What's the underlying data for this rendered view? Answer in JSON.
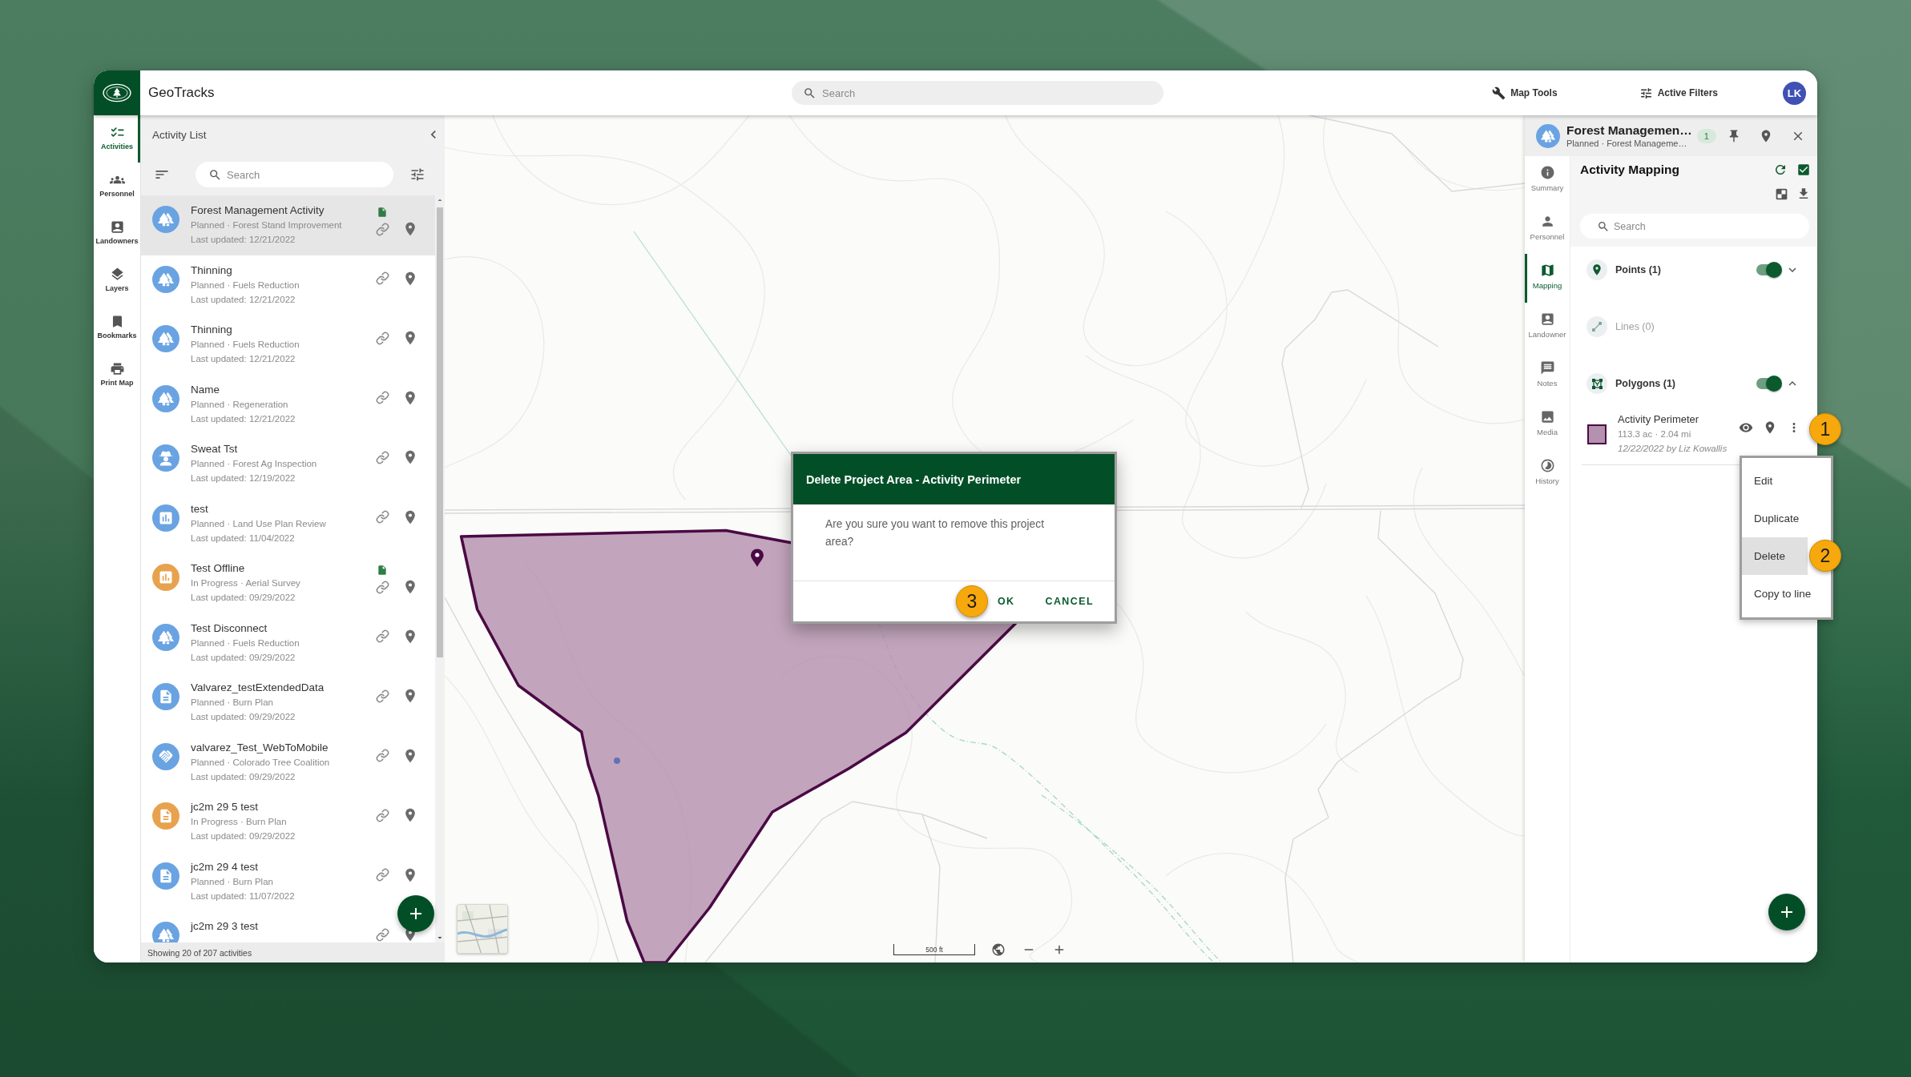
{
  "top_bar": {
    "app_name": "GeoTracks",
    "search": {
      "placeholder": "Search"
    },
    "tools": [
      "Map Tools",
      "Active Filters"
    ],
    "user_initials": "LK"
  },
  "nav": [
    {
      "label": "Activities",
      "selected": true
    },
    {
      "label": "Personnel",
      "selected": false
    },
    {
      "label": "Landowners",
      "selected": false
    },
    {
      "label": "Layers",
      "selected": false
    },
    {
      "label": "Bookmarks",
      "selected": false
    },
    {
      "label": "Print Map",
      "selected": false
    }
  ],
  "activity_list": {
    "title": "Activity List",
    "search": {
      "placeholder": "Search"
    },
    "items": [
      {
        "title": "Forest Management Activity",
        "subtitle": "Planned · Forest Stand Improvement",
        "updated": "Last updated: 12/21/2022",
        "kind": "forestry",
        "color": "#6aa3e2",
        "attachment": true,
        "selected": true
      },
      {
        "title": "Thinning",
        "subtitle": "Planned · Fuels Reduction",
        "updated": "Last updated: 12/21/2022",
        "kind": "forestry",
        "color": "#6aa3e2",
        "attachment": false,
        "selected": false
      },
      {
        "title": "Thinning",
        "subtitle": "Planned · Fuels Reduction",
        "updated": "Last updated: 12/21/2022",
        "kind": "forestry",
        "color": "#6aa3e2",
        "attachment": false,
        "selected": false
      },
      {
        "title": "Name",
        "subtitle": "Planned · Regeneration",
        "updated": "Last updated: 12/21/2022",
        "kind": "forestry",
        "color": "#6aa3e2",
        "attachment": false,
        "selected": false
      },
      {
        "title": "Sweat Tst",
        "subtitle": "Planned · Forest Ag Inspection",
        "updated": "Last updated: 12/19/2022",
        "kind": "inspection",
        "color": "#6aa3e2",
        "attachment": false,
        "selected": false
      },
      {
        "title": "test",
        "subtitle": "Planned · Land Use Plan Review",
        "updated": "Last updated: 11/04/2022",
        "kind": "survey",
        "color": "#6aa3e2",
        "attachment": false,
        "selected": false
      },
      {
        "title": "Test Offline",
        "subtitle": "In Progress · Aerial Survey",
        "updated": "Last updated: 09/29/2022",
        "kind": "survey",
        "color": "#e8a24d",
        "attachment": true,
        "selected": false
      },
      {
        "title": "Test Disconnect",
        "subtitle": "Planned · Fuels Reduction",
        "updated": "Last updated: 09/29/2022",
        "kind": "forestry",
        "color": "#6aa3e2",
        "attachment": false,
        "selected": false
      },
      {
        "title": "Valvarez_testExtendedData",
        "subtitle": "Planned · Burn Plan",
        "updated": "Last updated: 09/29/2022",
        "kind": "plan",
        "color": "#6aa3e2",
        "attachment": false,
        "selected": false
      },
      {
        "title": "valvarez_Test_WebToMobile",
        "subtitle": "Planned · Colorado Tree Coalition",
        "updated": "Last updated: 09/29/2022",
        "kind": "partnership",
        "color": "#6aa3e2",
        "attachment": false,
        "selected": false
      },
      {
        "title": "jc2m 29 5 test",
        "subtitle": "In Progress · Burn Plan",
        "updated": "Last updated: 09/29/2022",
        "kind": "plan",
        "color": "#e8a24d",
        "attachment": false,
        "selected": false
      },
      {
        "title": "jc2m 29 4 test",
        "subtitle": "Planned · Burn Plan",
        "updated": "Last updated: 11/07/2022",
        "kind": "plan",
        "color": "#6aa3e2",
        "attachment": false,
        "selected": false
      },
      {
        "title": "jc2m 29 3 test",
        "kind": "forestry",
        "color": "#6aa3e2",
        "attachment": false,
        "selected": false
      }
    ],
    "footer": "Showing 20 of 207 activities"
  },
  "map": {
    "scale": "500 ft"
  },
  "dialog": {
    "title": "Delete Project Area - Activity Perimeter",
    "message": "Are you sure you want to remove this project area?",
    "callout": "3",
    "buttons": [
      "OK",
      "CANCEL"
    ]
  },
  "detail_panel": {
    "title": "Forest Managemen…",
    "subtitle": "Planned · Forest Manageme…",
    "count": "1",
    "tabs": [
      {
        "label": "Summary",
        "selected": false
      },
      {
        "label": "Personnel",
        "selected": false
      },
      {
        "label": "Mapping",
        "selected": true
      },
      {
        "label": "Landowner",
        "selected": false
      },
      {
        "label": "Notes",
        "selected": false
      },
      {
        "label": "Media",
        "selected": false
      },
      {
        "label": "History",
        "selected": false
      }
    ],
    "heading": "Activity Mapping",
    "header_checkbox": {
      "checked": true
    },
    "search": {
      "placeholder": "Search"
    },
    "layers": [
      {
        "label": "Points (1)",
        "kind": "points",
        "disabled": false,
        "on": true,
        "expanded": false
      },
      {
        "label": "Lines (0)",
        "kind": "lines",
        "disabled": true
      },
      {
        "label": "Polygons (1)",
        "kind": "polygons",
        "disabled": false,
        "on": true,
        "expanded": true,
        "features": [
          {
            "name": "Activity Perimeter",
            "stats": "113.3 ac · 2.04 mi",
            "author": "12/22/2022 by Liz Kowallis",
            "color": "#b491ae",
            "callout": "1",
            "menu": [
              {
                "label": "Edit",
                "selected": false
              },
              {
                "label": "Duplicate",
                "selected": false
              },
              {
                "label": "Delete",
                "selected": true,
                "callout": "2"
              },
              {
                "label": "Copy to line",
                "selected": false
              }
            ]
          }
        ]
      }
    ]
  }
}
